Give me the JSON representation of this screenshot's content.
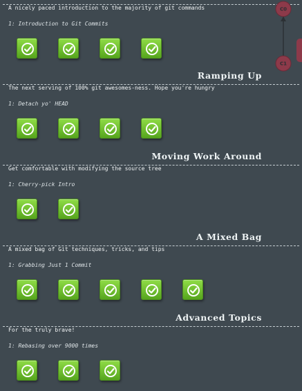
{
  "sections": [
    {
      "title": "",
      "description": "A nicely paced introduction to the majority of git commands",
      "level_name": "1: Introduction to Git Commits",
      "levels": 4
    },
    {
      "title": "Ramping Up",
      "description": "The next serving of 100% git awesomes-ness. Hope you're hungry",
      "level_name": "1: Detach yo' HEAD",
      "levels": 4
    },
    {
      "title": "Moving Work Around",
      "description": "Get comfortable with modifying the source tree",
      "level_name": "1: Cherry-pick Intro",
      "levels": 2
    },
    {
      "title": "A Mixed Bag",
      "description": "A mixed bag of Git techniques, tricks, and tips",
      "level_name": "1: Grabbing Just 1 Commit",
      "levels": 5
    },
    {
      "title": "Advanced Topics",
      "description": "For the truly brave!",
      "level_name": "1: Rebasing over 9000 times",
      "levels": 3
    }
  ],
  "commit_tree": {
    "nodes": [
      "C0",
      "C1"
    ],
    "node_color": "#8d3a4a"
  },
  "colors": {
    "background": "#3f4950",
    "button_top": "#8fdc47",
    "button_bottom": "#56a51d",
    "text": "#eef2f3"
  }
}
